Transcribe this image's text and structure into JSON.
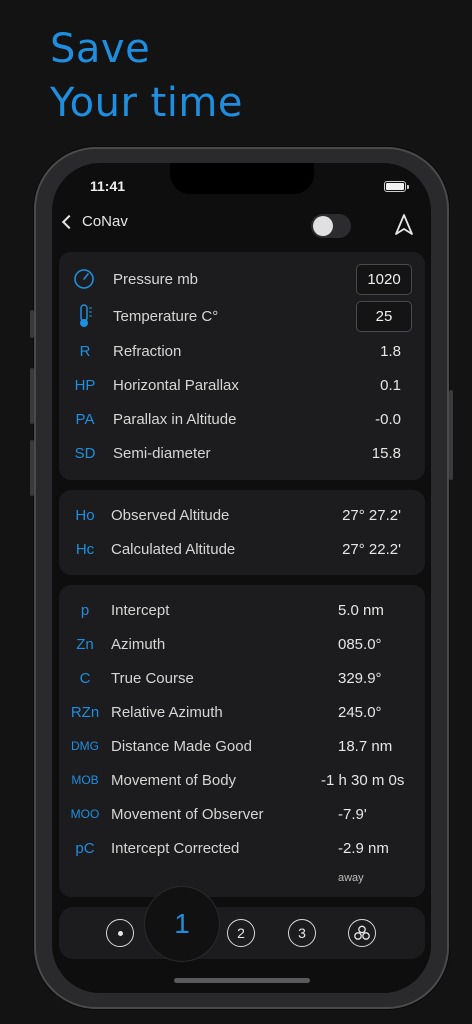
{
  "headline": {
    "line1": "Save",
    "line2": "Your time"
  },
  "status": {
    "time": "11:41"
  },
  "nav": {
    "back_label": "CoNav"
  },
  "colors": {
    "accent": "#1e8fe0",
    "card": "#1c1c1e",
    "background": "#131313"
  },
  "inputs": [
    {
      "icon": "gauge-icon",
      "label": "Pressure   mb",
      "value": "1020"
    },
    {
      "icon": "thermometer-icon",
      "label": "Temperature   C°",
      "value": "25"
    }
  ],
  "corrections": [
    {
      "abbr": "R",
      "label": "Refraction",
      "value": "1.8"
    },
    {
      "abbr": "HP",
      "label": "Horizontal Parallax",
      "value": "0.1"
    },
    {
      "abbr": "PA",
      "label": "Parallax in Altitude",
      "value": "-0.0"
    },
    {
      "abbr": "SD",
      "label": "Semi-diameter",
      "value": "15.8"
    }
  ],
  "altitudes": [
    {
      "abbr": "Ho",
      "label": "Observed Altitude",
      "value": "27° 27.2'"
    },
    {
      "abbr": "Hc",
      "label": "Calculated Altitude",
      "value": "27° 22.2'"
    }
  ],
  "results": [
    {
      "abbr": "p",
      "label": "Intercept",
      "value": "5.0 nm"
    },
    {
      "abbr": "Zn",
      "label": "Azimuth",
      "value": "085.0°"
    },
    {
      "abbr": "C",
      "label": "True Course",
      "value": "329.9°"
    },
    {
      "abbr": "RZn",
      "label": "Relative Azimuth",
      "value": "245.0°"
    },
    {
      "abbr": "DMG",
      "label": "Distance Made Good",
      "value": "18.7 nm"
    },
    {
      "abbr": "MOB",
      "label": "Movement of Body",
      "value": "-1 h 30 m 0s"
    },
    {
      "abbr": "MOO",
      "label": "Movement of Observer",
      "value": "-7.9'"
    },
    {
      "abbr": "pC",
      "label": "Intercept Corrected",
      "value": "-2.9 nm"
    }
  ],
  "intercept_direction": "away",
  "tabs": {
    "active": "1",
    "t2": "2",
    "t3": "3"
  }
}
